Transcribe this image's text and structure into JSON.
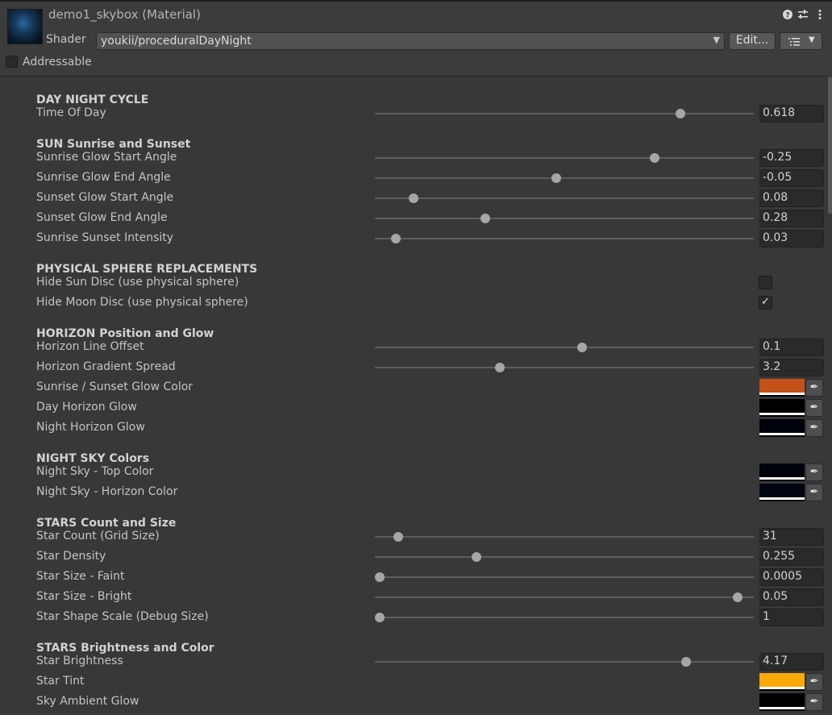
{
  "header": {
    "title": "demo1_skybox (Material)",
    "help_icon": "question-circle-icon",
    "preset_icon": "sliders-icon",
    "menu_icon": "kebab-menu-icon",
    "shader_label": "Shader",
    "shader_value": "youkii/proceduralDayNight",
    "edit_label": "Edit...",
    "options_icon": "list-options-icon",
    "addressable_label": "Addressable",
    "addressable_checked": false
  },
  "sections": {
    "day_night": {
      "heading": "DAY  NIGHT  CYCLE",
      "time_of_day": {
        "label": "Time Of Day",
        "value": "0.618",
        "fraction": 0.815
      }
    },
    "sun": {
      "heading": "SUN  Sunrise and Sunset",
      "glow_start": {
        "label": "Sunrise Glow Start Angle",
        "value": "-0.25",
        "fraction": 0.745
      },
      "glow_end": {
        "label": "Sunrise Glow End Angle",
        "value": "-0.05",
        "fraction": 0.478
      },
      "sunset_start": {
        "label": "Sunset Glow Start Angle",
        "value": "0.08",
        "fraction": 0.091
      },
      "sunset_end": {
        "label": "Sunset Glow End Angle",
        "value": "0.28",
        "fraction": 0.287
      },
      "intensity": {
        "label": "Sunrise Sunset Intensity",
        "value": "0.03",
        "fraction": 0.043
      }
    },
    "physical": {
      "heading": "PHYSICAL SPHERE REPLACEMENTS",
      "hide_sun": {
        "label": "Hide Sun Disc (use physical sphere)",
        "checked": false
      },
      "hide_moon": {
        "label": "Hide Moon Disc (use physical sphere)",
        "checked": true,
        "mark": "✓"
      }
    },
    "horizon": {
      "heading": "HORIZON  Position and Glow",
      "line_offset": {
        "label": "Horizon Line Offset",
        "value": "0.1",
        "fraction": 0.549
      },
      "gradient_spread": {
        "label": "Horizon Gradient Spread",
        "value": "3.2",
        "fraction": 0.326
      },
      "sunset_glow_color": {
        "label": "Sunrise / Sunset Glow Color",
        "color": "#c4501a"
      },
      "day_glow": {
        "label": "Day Horizon Glow",
        "color": "#000000"
      },
      "night_glow": {
        "label": "Night Horizon Glow",
        "color": "#01030c"
      }
    },
    "night_sky": {
      "heading": "NIGHT SKY  Colors",
      "top_color": {
        "label": "Night Sky - Top Color",
        "color": "#01030c"
      },
      "horizon_color": {
        "label": "Night Sky - Horizon Color",
        "color": "#010512"
      }
    },
    "stars": {
      "heading": "STARS  Count and Size",
      "count": {
        "label": "Star Count (Grid Size)",
        "value": "31",
        "fraction": 0.051
      },
      "density": {
        "label": "Star Density",
        "value": "0.255",
        "fraction": 0.262
      },
      "size_faint": {
        "label": "Star Size - Faint",
        "value": "0.0005",
        "fraction": 0.0
      },
      "size_bright": {
        "label": "Star Size - Bright",
        "value": "0.05",
        "fraction": 0.97
      },
      "shape_scale": {
        "label": "Star Shape Scale (Debug Size)",
        "value": "1",
        "fraction": 0.0
      }
    },
    "stars_brightness": {
      "heading": "STARS  Brightness and Color",
      "brightness": {
        "label": "Star Brightness",
        "value": "4.17",
        "fraction": 0.83
      },
      "tint": {
        "label": "Star Tint",
        "color": "#f9a90a"
      },
      "ambient": {
        "label": "Sky Ambient Glow",
        "color": "#000000"
      }
    }
  },
  "picker_icon": "eyedropper-icon"
}
